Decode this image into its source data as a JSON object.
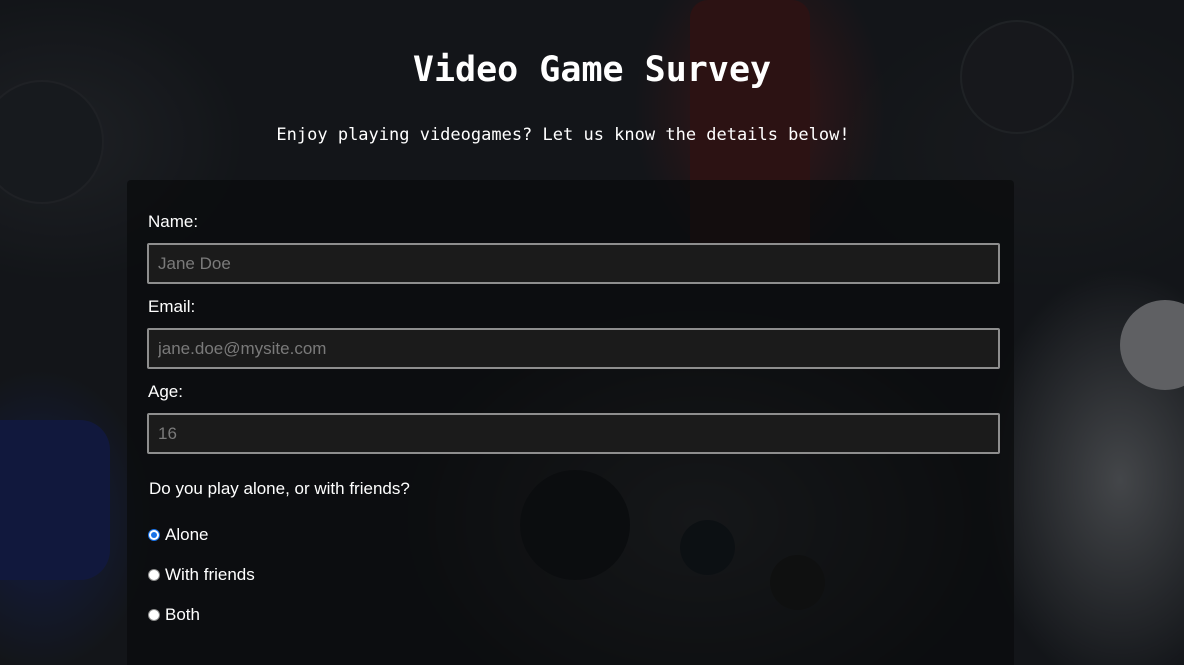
{
  "header": {
    "title": "Video Game Survey",
    "subtitle": "Enjoy playing videogames? Let us know the details below!"
  },
  "form": {
    "name": {
      "label": "Name:",
      "placeholder": "Jane Doe",
      "value": ""
    },
    "email": {
      "label": "Email:",
      "placeholder": "jane.doe@mysite.com",
      "value": ""
    },
    "age": {
      "label": "Age:",
      "placeholder": "16",
      "value": ""
    },
    "play_question": {
      "label": "Do you play alone, or with friends?",
      "options": [
        {
          "label": "Alone",
          "checked": true
        },
        {
          "label": "With friends",
          "checked": false
        },
        {
          "label": "Both",
          "checked": false
        }
      ]
    }
  },
  "colors": {
    "accent": "#1a73e8",
    "input_background": "#1b1b1b",
    "input_border": "#8e8e8e",
    "text": "#ffffff"
  }
}
